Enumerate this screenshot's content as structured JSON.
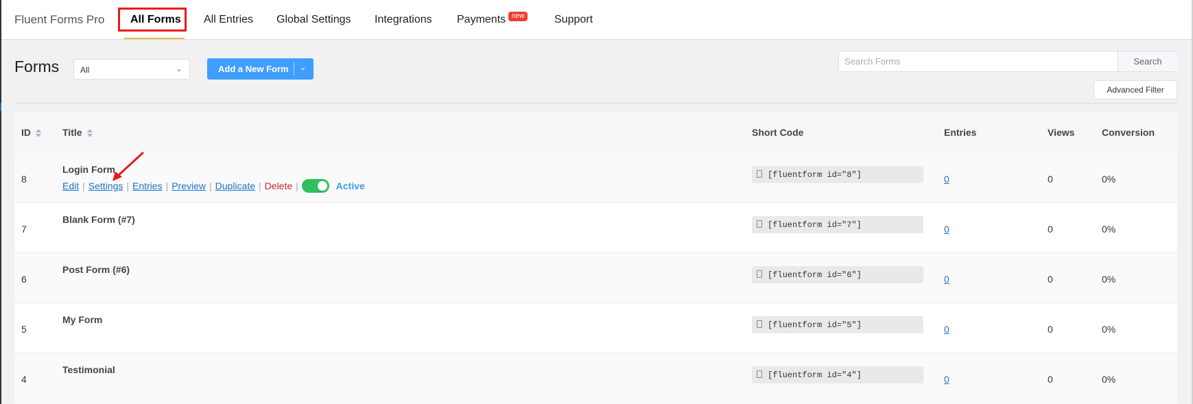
{
  "brand": "Fluent Forms Pro",
  "nav": {
    "items": [
      {
        "label": "All Forms",
        "active": true
      },
      {
        "label": "All Entries"
      },
      {
        "label": "Global Settings"
      },
      {
        "label": "Integrations"
      },
      {
        "label": "Payments",
        "badge": "new"
      },
      {
        "label": "Support"
      }
    ]
  },
  "header": {
    "title": "Forms",
    "filter_value": "All",
    "add_button": "Add a New Form",
    "search_placeholder": "Search Forms",
    "search_button": "Search",
    "advanced_filter": "Advanced Filter"
  },
  "table": {
    "columns": [
      "ID",
      "Title",
      "Short Code",
      "Entries",
      "Views",
      "Conversion"
    ],
    "row_actions": [
      "Edit",
      "Settings",
      "Entries",
      "Preview",
      "Duplicate",
      "Delete"
    ],
    "status_label": "Active",
    "rows": [
      {
        "id": "8",
        "title": "Login Form",
        "shortcode": "[fluentform id=\"8\"]",
        "entries": "0",
        "views": "0",
        "conversion": "0%"
      },
      {
        "id": "7",
        "title": "Blank Form (#7)",
        "shortcode": "[fluentform id=\"7\"]",
        "entries": "0",
        "views": "0",
        "conversion": "0%"
      },
      {
        "id": "6",
        "title": "Post Form (#6)",
        "shortcode": "[fluentform id=\"6\"]",
        "entries": "0",
        "views": "0",
        "conversion": "0%"
      },
      {
        "id": "5",
        "title": "My Form",
        "shortcode": "[fluentform id=\"5\"]",
        "entries": "0",
        "views": "0",
        "conversion": "0%"
      },
      {
        "id": "4",
        "title": "Testimonial",
        "shortcode": "[fluentform id=\"4\"]",
        "entries": "0",
        "views": "0",
        "conversion": "0%"
      }
    ]
  },
  "colors": {
    "primary": "#409eff",
    "highlight_box": "#e8191f",
    "toggle_on": "#2ec05e",
    "link": "#1a73c9",
    "delete": "#c52626",
    "badge": "#ef3e36"
  }
}
